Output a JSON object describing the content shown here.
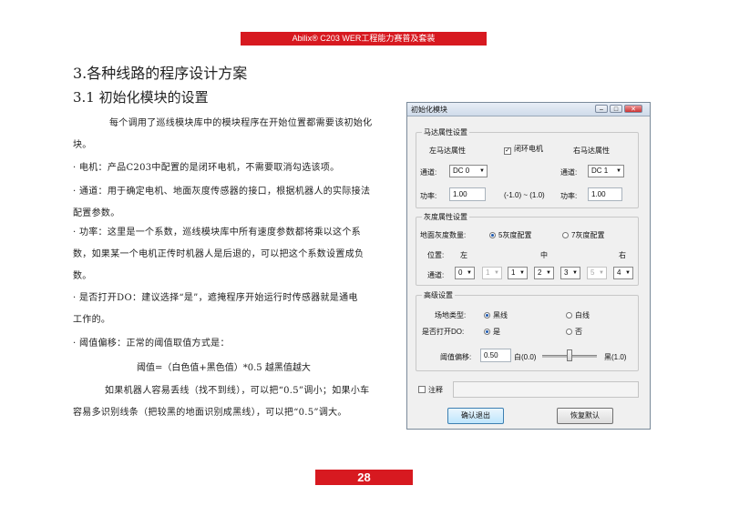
{
  "header": {
    "title": "Abilix® C203 WER工程能力赛普及套装"
  },
  "doc": {
    "h1": "3.各种线路的程序设计方案",
    "h2": "3.1 初始化模块的设置",
    "p1_l1": "每个调用了巡线模块库中的模块程序在开始位置都需要该初始化",
    "p1_l2": "块。",
    "p2": "· 电机：产品C203中配置的是闭环电机，不需要取消勾选该项。",
    "p3_l1": "· 通道：用于确定电机、地面灰度传感器的接口，根据机器人的实际接法",
    "p3_l2": "配置参数。",
    "p4_l1": "· 功率：这里是一个系数，巡线模块库中所有速度参数都将乘以这个系",
    "p4_l2": "数，如果某一个电机正传时机器人是后退的，可以把这个系数设置成负",
    "p4_l3": "数。",
    "p5_l1": "· 是否打开DO：建议选择“是”，遮掩程序开始运行时传感器就是通电",
    "p5_l2": "工作的。",
    "p6": "· 阈值偏移：正常的阈值取值方式是：",
    "formula": "阈值=（白色值+黑色值）*0.5   越黑值越大",
    "p7_l1": "如果机器人容易丢线（找不到线），可以把“0.5”调小；如果小车",
    "p7_l2": "容易多识别线条（把较黑的地面识别成黑线），可以把“0.5”调大。"
  },
  "dialog": {
    "title": "初始化模块",
    "motor": {
      "group_title": "马达属性设置",
      "left_title": "左马达属性",
      "closed_loop_label": "闭环电机",
      "closed_loop_checked": true,
      "right_title": "右马达属性",
      "channel_label": "通道:",
      "left_channel": "DC 0",
      "right_channel": "DC 1",
      "power_label": "功率:",
      "left_power": "1.00",
      "range_hint": "(-1.0) ~ (1.0)",
      "right_power": "1.00"
    },
    "gray": {
      "group_title": "灰度属性设置",
      "count_label": "地面灰度数量:",
      "opt5": "5灰度配置",
      "opt7": "7灰度配置",
      "position_label": "位置:",
      "pos_left": "左",
      "pos_mid": "中",
      "pos_right": "右",
      "channel_label": "通道:",
      "channels": [
        "0",
        "1",
        "1",
        "2",
        "3",
        "5",
        "4"
      ]
    },
    "advanced": {
      "group_title": "高级设置",
      "field_label": "场地类型:",
      "black_line": "黑线",
      "white_line": "白线",
      "do_label": "是否打开DO:",
      "yes": "是",
      "no": "否",
      "offset_label": "阈值偏移:",
      "offset_value": "0.50",
      "white_end": "白(0.0)",
      "black_end": "黑(1.0)",
      "slider_fraction": 0.5
    },
    "note_label": "注释",
    "ok_button": "确认退出",
    "reset_button": "恢复默认"
  },
  "page_number": "28"
}
